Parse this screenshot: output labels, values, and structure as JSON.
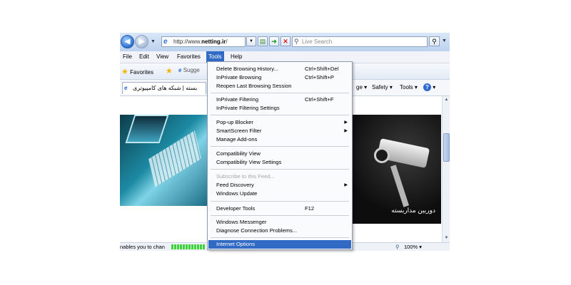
{
  "browser": {
    "address": {
      "url_prefix": "http://www.",
      "url_domain": "netting.ir",
      "url_suffix": "/"
    },
    "search": {
      "placeholder": "Live Search"
    },
    "menu": [
      "File",
      "Edit",
      "View",
      "Favorites",
      "Tools",
      "Help"
    ],
    "favorites_bar": {
      "favorites_label": "Favorites",
      "suggested_label": "Sugge"
    },
    "tab": {
      "title": "بسته | شبکه های کامپیوتری"
    },
    "command_bar": {
      "page_fragment": "ge",
      "safety": "Safety",
      "tools": "Tools"
    },
    "status_bar": {
      "text": "nables you to chan",
      "zoom": "100%"
    }
  },
  "content": {
    "image_caption": "دوربین مداربسته"
  },
  "tools_menu": {
    "items": [
      {
        "label": "Delete Browsing History...",
        "shortcut": "Ctrl+Shift+Del"
      },
      {
        "label": "InPrivate Browsing",
        "shortcut": "Ctrl+Shift+P"
      },
      {
        "label": "Reopen Last Browsing Session",
        "shortcut": ""
      },
      {
        "label": "InPrivate Filtering",
        "shortcut": "Ctrl+Shift+F"
      },
      {
        "label": "InPrivate Filtering Settings",
        "shortcut": ""
      },
      {
        "label": "Pop-up Blocker",
        "shortcut": ""
      },
      {
        "label": "SmartScreen Filter",
        "shortcut": ""
      },
      {
        "label": "Manage Add-ons",
        "shortcut": ""
      },
      {
        "label": "Compatibility View",
        "shortcut": ""
      },
      {
        "label": "Compatibility View Settings",
        "shortcut": ""
      },
      {
        "label": "Subscribe to this Feed...",
        "shortcut": ""
      },
      {
        "label": "Feed Discovery",
        "shortcut": ""
      },
      {
        "label": "Windows Update",
        "shortcut": ""
      },
      {
        "label": "Developer Tools",
        "shortcut": "F12"
      },
      {
        "label": "Windows Messenger",
        "shortcut": ""
      },
      {
        "label": "Diagnose Connection Problems...",
        "shortcut": ""
      },
      {
        "label": "Internet Options",
        "shortcut": ""
      }
    ]
  },
  "colors": {
    "menu_highlight": "#316ac5",
    "toolbar": "#d9e7f8"
  }
}
